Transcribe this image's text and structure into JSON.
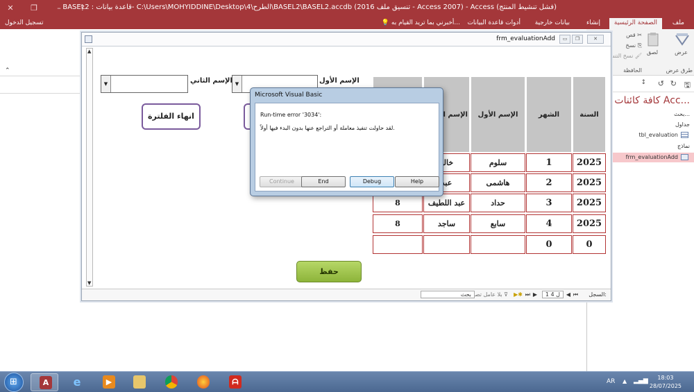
{
  "window": {
    "title": "BASEL2 : قاعدة بيانات- C:\\Users\\MOHYIDDINE\\Desktop\\4\\الطرح\\BASEL2\\BASEL2.accdb (تنسيق ملف 2016 - Access 2007) - Access (فشل تنشيط المنتج)",
    "help_glyph": "?",
    "min_glyph": "–",
    "restore_glyph": "❐",
    "close_glyph": "✕"
  },
  "tabs": [
    "ملف",
    "الصفحة الرئيسية",
    "إنشاء",
    "بيانات خارجية",
    "أدوات قاعدة البيانات"
  ],
  "tell_me": "أخبرني بما تريد القيام به...",
  "sign_in": "تسجيل الدخول",
  "ribbon": {
    "view_label": "عرض",
    "views_group": "طرق عرض",
    "paste_label": "لصق",
    "cut_label": "قص",
    "copy_label": "نسخ",
    "format_painter_label": "نسخ التنسيق",
    "clipboard_group": "الحافظة"
  },
  "nav": {
    "title": "كافة كائنات Acc...",
    "search_placeholder": "بحث...",
    "groups": [
      {
        "name": "جداول",
        "items": [
          "tbl_evaluation"
        ]
      },
      {
        "name": "نماذج",
        "items": [
          "frm_evaluationAdd"
        ]
      }
    ]
  },
  "form": {
    "title": "frm_evaluationAdd",
    "first_name_label": "الإسم الأول",
    "second_name_label": "الإسم الثاني",
    "filter_end_button": "انهاء الفلترة",
    "save_button": "حفظ",
    "grid": {
      "headers": [
        "السنة",
        "الشهر",
        "الإسم الأول",
        "الإسم الثاني"
      ],
      "rows": [
        [
          "2025",
          "1",
          "سلوم",
          "خالد",
          ""
        ],
        [
          "2025",
          "2",
          "هاشمى",
          "عبد",
          ""
        ],
        [
          "2025",
          "3",
          "حداد",
          "عبد اللطيف",
          "8"
        ],
        [
          "2025",
          "4",
          "سابع",
          "ساجد",
          "8"
        ],
        [
          "0",
          "0",
          "",
          "",
          ""
        ]
      ]
    },
    "record_nav": {
      "record_label": "السجل:",
      "position": "1 ل 4",
      "no_filter": "بلا عامل تصفية",
      "search": "بحث"
    }
  },
  "dialog": {
    "title": "Microsoft Visual Basic",
    "error_line": "Run-time error '3034':",
    "message": "لقد حاولت تنفيذ معاملة أو التراجع عنها بدون البدء فيها أولاً.",
    "buttons": {
      "continue": "Continue",
      "end": "End",
      "debug": "Debug",
      "help": "Help"
    }
  },
  "taskbar": {
    "lang": "AR",
    "time": "18:03",
    "date": "28/07/2025"
  },
  "colors": {
    "access_red": "#a4373a",
    "dialog_frame": "#b8cde3",
    "save_green": "#8db43a"
  }
}
